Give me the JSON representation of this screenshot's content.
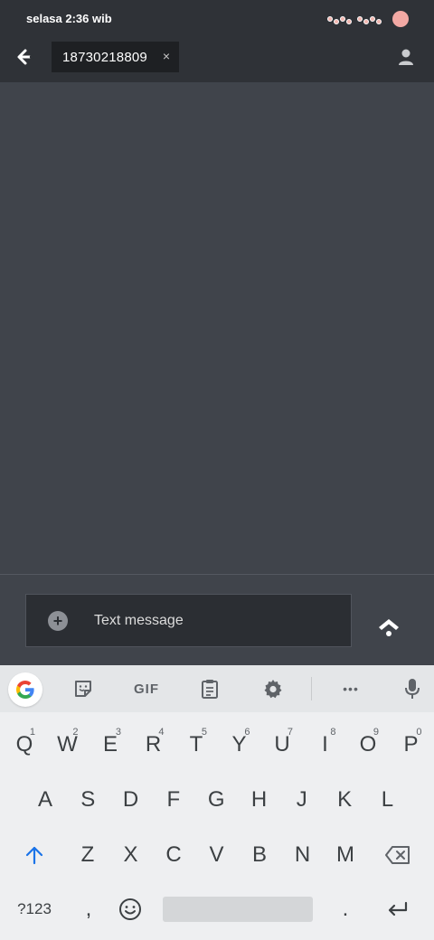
{
  "status_bar": {
    "time": "selasa 2:36 wib"
  },
  "header": {
    "recipient": "18730218809",
    "chip_close": "×"
  },
  "compose": {
    "placeholder": "Text message",
    "attach_symbol": "+"
  },
  "keyboard": {
    "toolbar": {
      "gif_label": "GIF",
      "more_label": "•••"
    },
    "row1": [
      {
        "key": "Q",
        "hint": "1"
      },
      {
        "key": "W",
        "hint": "2"
      },
      {
        "key": "E",
        "hint": "3"
      },
      {
        "key": "R",
        "hint": "4"
      },
      {
        "key": "T",
        "hint": "5"
      },
      {
        "key": "Y",
        "hint": "6"
      },
      {
        "key": "U",
        "hint": "7"
      },
      {
        "key": "I",
        "hint": "8"
      },
      {
        "key": "O",
        "hint": "9"
      },
      {
        "key": "P",
        "hint": "0"
      }
    ],
    "row2": [
      "A",
      "S",
      "D",
      "F",
      "G",
      "H",
      "J",
      "K",
      "L"
    ],
    "row3": [
      "Z",
      "X",
      "C",
      "V",
      "B",
      "N",
      "M"
    ],
    "row4": {
      "symbols": "?123",
      "comma": ",",
      "period": "."
    }
  },
  "colors": {
    "accent_shift": "#1a73e8",
    "google_blue": "#4285f4",
    "google_red": "#ea4335",
    "google_yellow": "#fbbc05",
    "google_green": "#34a853"
  }
}
